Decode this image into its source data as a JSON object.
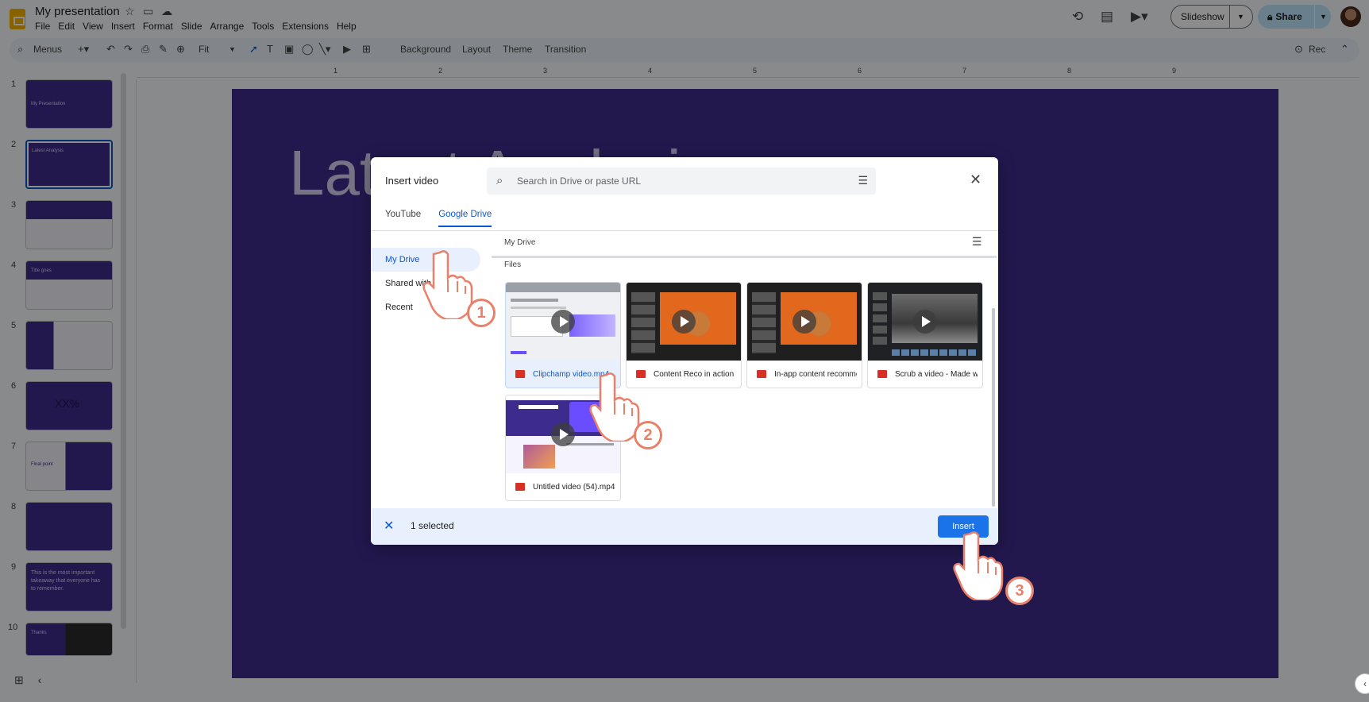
{
  "app": {
    "title": "My presentation",
    "menu": [
      "File",
      "Edit",
      "View",
      "Insert",
      "Format",
      "Slide",
      "Arrange",
      "Tools",
      "Extensions",
      "Help"
    ],
    "slideshow_label": "Slideshow",
    "share_label": "Share"
  },
  "toolbar": {
    "menus_label": "Menus",
    "zoom_label": "Fit",
    "background_label": "Background",
    "layout_label": "Layout",
    "theme_label": "Theme",
    "transition_label": "Transition",
    "rec_label": "Rec"
  },
  "ruler": [
    "1",
    "2",
    "3",
    "4",
    "5",
    "6",
    "7",
    "8",
    "9"
  ],
  "slides": [
    {
      "num": "1",
      "text": "My Presentation"
    },
    {
      "num": "2",
      "text": "Latest Analysis"
    },
    {
      "num": "3",
      "text": ""
    },
    {
      "num": "4",
      "text": "Title goes"
    },
    {
      "num": "5",
      "text": ""
    },
    {
      "num": "6",
      "text": "XX%"
    },
    {
      "num": "7",
      "text": "Final point"
    },
    {
      "num": "8",
      "text": ""
    },
    {
      "num": "9",
      "text": "This is the most important takeaway that everyone has to remember."
    },
    {
      "num": "10",
      "text": "Thanks"
    }
  ],
  "slide_title": "Latest Analysis",
  "dialog": {
    "title": "Insert video",
    "search_placeholder": "Search in Drive or paste URL",
    "tabs": [
      "YouTube",
      "Google Drive"
    ],
    "active_tab": "Google Drive",
    "nav": [
      "My Drive",
      "Shared with me",
      "Recent"
    ],
    "path": "My Drive",
    "files_label": "Files",
    "files": [
      {
        "name": "Clipchamp video.mp4",
        "selected": true
      },
      {
        "name": "Content Reco in action",
        "selected": false
      },
      {
        "name": "In-app content recommendations",
        "selected": false
      },
      {
        "name": "Scrub a video - Made with Clipchamp",
        "selected": false
      },
      {
        "name": "Untitled video (54).mp4",
        "selected": false
      }
    ],
    "selected_count": "1 selected",
    "insert_label": "Insert"
  },
  "steps": [
    "1",
    "2",
    "3"
  ],
  "colors": {
    "accent": "#0b57d0",
    "slide_bg": "#3e2c8e",
    "step_badge": "#e8806a",
    "insert_button": "#1a73e8"
  }
}
